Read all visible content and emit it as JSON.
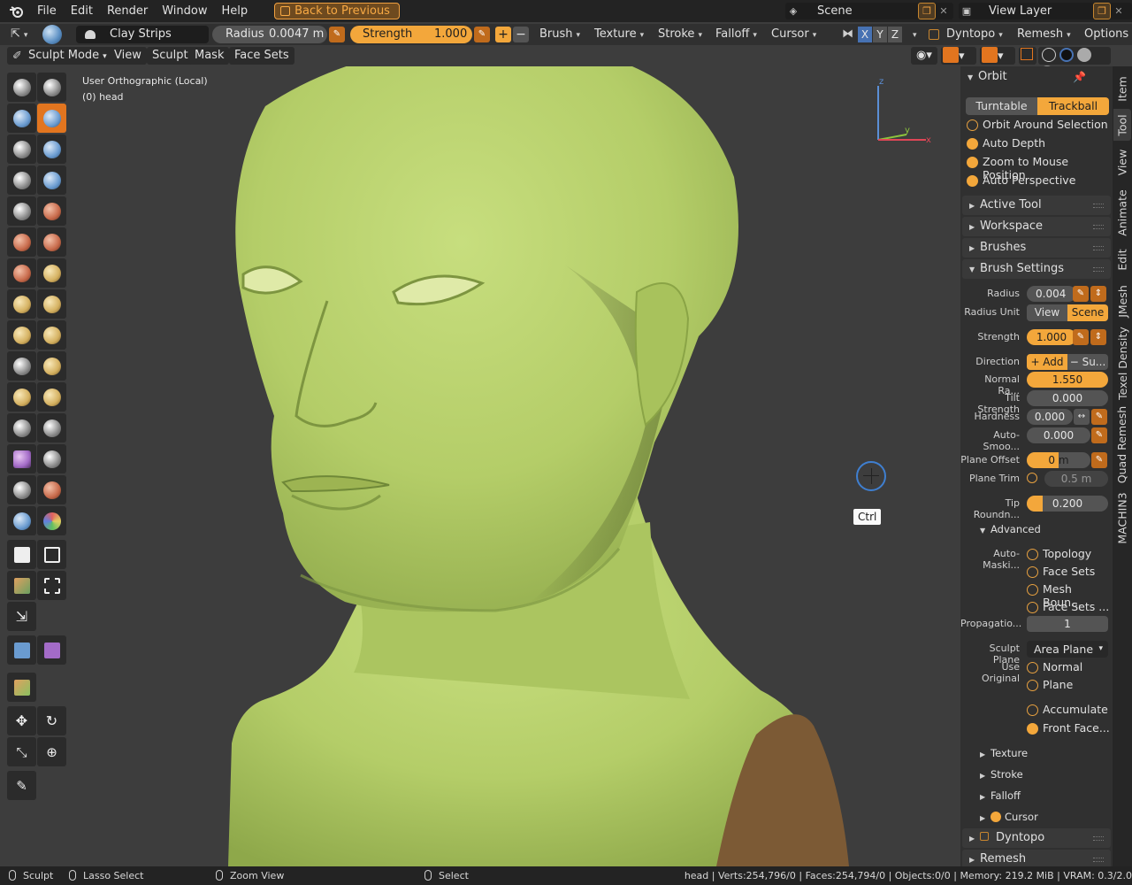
{
  "menubar": {
    "items": [
      "File",
      "Edit",
      "Render",
      "Window",
      "Help"
    ],
    "back_button": "Back to Previous",
    "scene_name": "Scene",
    "view_layer_name": "View Layer"
  },
  "tool_header": {
    "brush_name": "Clay Strips",
    "radius_label": "Radius",
    "radius_value": "0.0047 m",
    "strength_label": "Strength",
    "strength_value": "1.000",
    "plus": "+",
    "minus": "−",
    "menus": [
      "Brush",
      "Texture",
      "Stroke",
      "Falloff",
      "Cursor"
    ],
    "axis_x": "X",
    "axis_y": "Y",
    "axis_z": "Z",
    "dyntopo": "Dyntopo",
    "remesh": "Remesh",
    "options": "Options"
  },
  "mode_header": {
    "mode": "Sculpt Mode",
    "menus": [
      "View",
      "Sculpt",
      "Mask",
      "Face Sets"
    ]
  },
  "viewport": {
    "view_name": "User Orthographic (Local)",
    "object_name": "(0) head",
    "tooltip_key": "Ctrl",
    "gizmo_z": "z",
    "gizmo_y": "y",
    "gizmo_x": "x",
    "colors": {
      "skin": "#b7cf6a",
      "cut_face": "#7c5a35",
      "background": "#3d3d3d"
    }
  },
  "npanel": {
    "orbit": {
      "title": "Orbit",
      "turntable": "Turntable",
      "trackball": "Trackball",
      "options": [
        {
          "label": "Orbit Around Selection",
          "checked": false
        },
        {
          "label": "Auto Depth",
          "checked": true
        },
        {
          "label": "Zoom to Mouse Position",
          "checked": true
        },
        {
          "label": "Auto Perspective",
          "checked": true
        }
      ]
    },
    "collapsed_panels": [
      "Active Tool",
      "Workspace",
      "Brushes"
    ],
    "brush_settings": {
      "title": "Brush Settings",
      "radius_label": "Radius",
      "radius_value": "0.004",
      "radius_unit_label": "Radius Unit",
      "unit_view": "View",
      "unit_scene": "Scene",
      "strength_label": "Strength",
      "strength_value": "1.000",
      "direction_label": "Direction",
      "direction_add": "+ Add",
      "direction_sub": "− Su...",
      "normal_radius_label": "Normal Ra...",
      "normal_radius_value": "1.550",
      "tilt_label": "Tilt Strength",
      "tilt_value": "0.000",
      "hardness_label": "Hardness",
      "hardness_value": "0.000",
      "autosmooth_label": "Auto-Smoo...",
      "autosmooth_value": "0.000",
      "plane_offset_label": "Plane Offset",
      "plane_offset_value": "0 m",
      "plane_offset_fill": 0.5,
      "plane_trim_label": "Plane Trim",
      "plane_trim_value": "0.5 m",
      "tip_round_label": "Tip Roundn...",
      "tip_round_value": "0.200",
      "tip_round_fill": 0.2
    },
    "advanced": {
      "title": "Advanced",
      "automask_label": "Auto-Maski...",
      "automask_options": [
        "Topology",
        "Face Sets",
        "Mesh Boun...",
        "Face Sets ..."
      ],
      "propagation_label": "Propagatio...",
      "propagation_value": "1",
      "sculpt_plane_label": "Sculpt Plane",
      "sculpt_plane_value": "Area Plane",
      "use_original_label": "Use Original",
      "use_original_normal": "Normal",
      "use_original_plane": "Plane",
      "accumulate": "Accumulate",
      "front_faces": "Front Face..."
    },
    "subpanels": [
      "Texture",
      "Stroke",
      "Falloff",
      "Cursor"
    ],
    "bottom_panels": [
      "Dyntopo",
      "Remesh"
    ]
  },
  "vertical_tabs": [
    "Item",
    "Tool",
    "View",
    "Animate",
    "Edit",
    "JMesh",
    "Texel Density",
    "Quad Remesh",
    "MACHIN3"
  ],
  "statusbar": {
    "sculpt": "Sculpt",
    "lasso": "Lasso Select",
    "zoom": "Zoom View",
    "select": "Select",
    "stats": "head | Verts:254,796/0 | Faces:254,794/0 | Objects:0/0 | Memory: 219.2 MiB | VRAM: 0.3/2.0"
  }
}
